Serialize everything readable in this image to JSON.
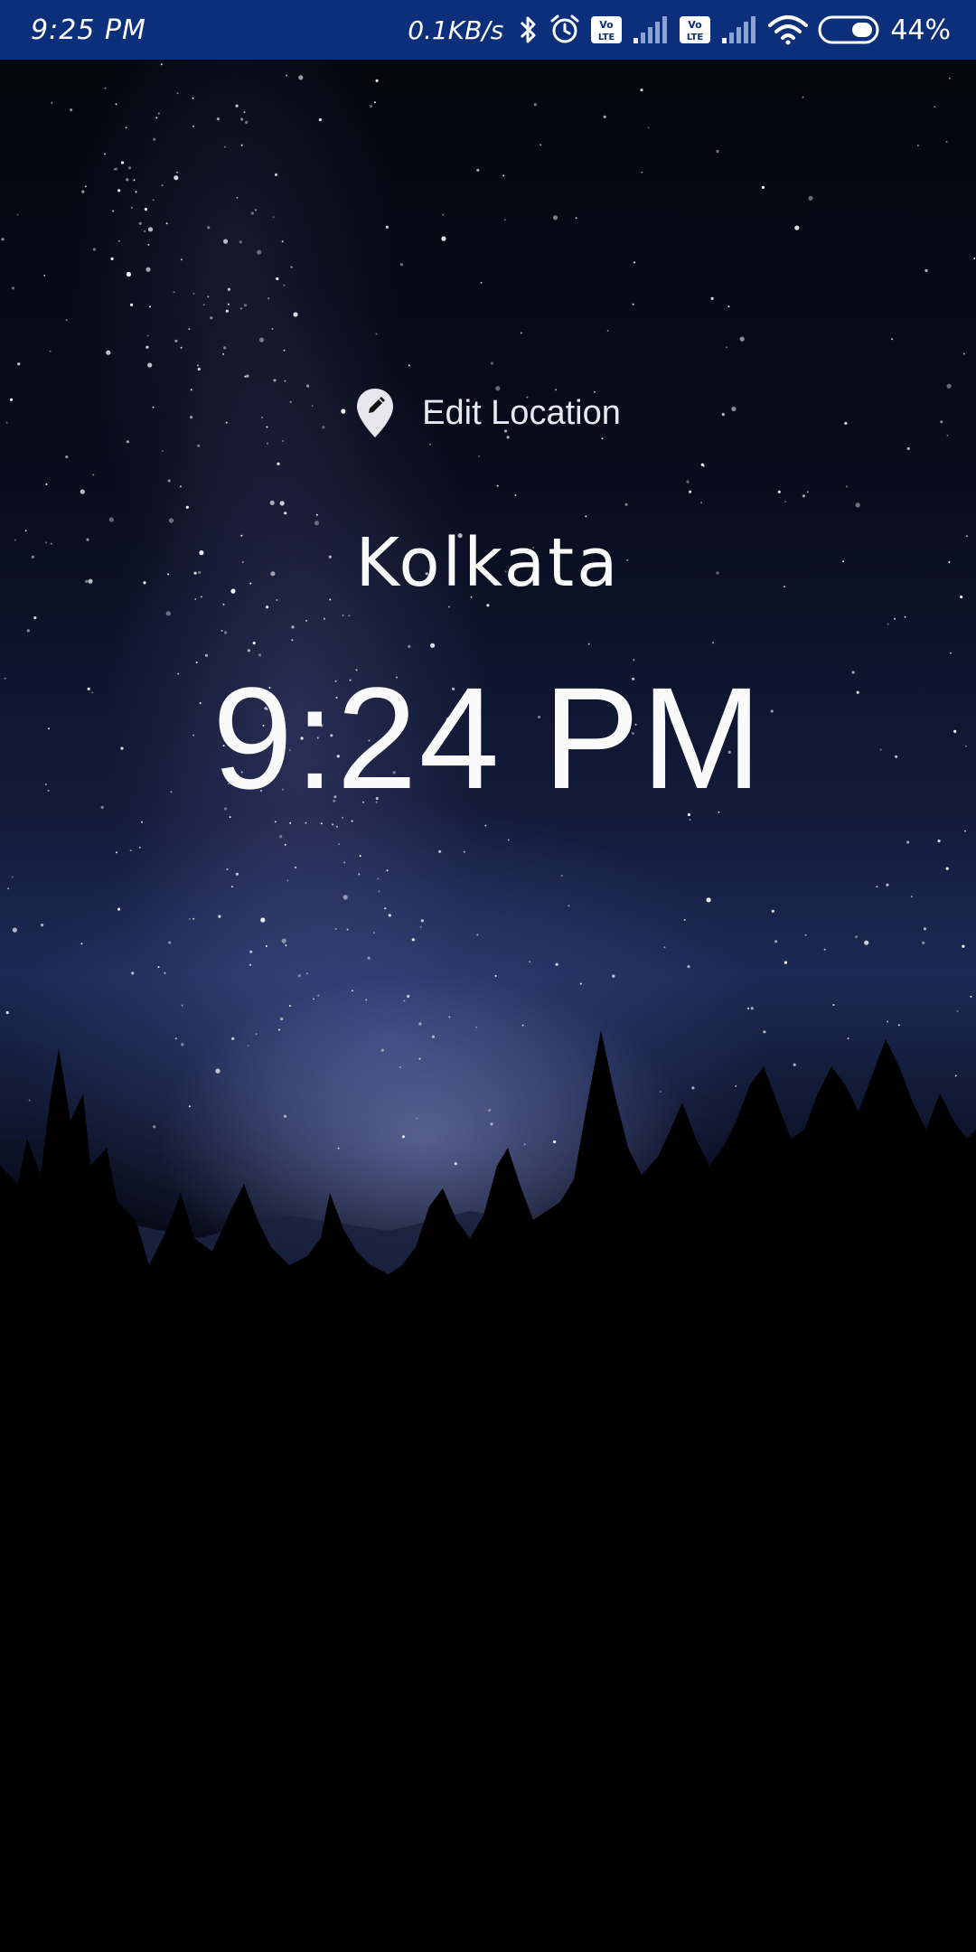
{
  "status_bar": {
    "time": "9:25 PM",
    "network_speed": "0.1KB/s",
    "battery_percent": "44%",
    "background_color": "#0b2f7a",
    "icons": [
      "bluetooth-icon",
      "alarm-icon",
      "volte-icon",
      "cellular-signal-icon",
      "volte-icon",
      "cellular-signal-icon",
      "wifi-icon",
      "battery-icon"
    ]
  },
  "location": {
    "edit_label": "Edit Location",
    "edit_icon": "location-pin-edit-icon",
    "city": "Kolkata",
    "time": "9:24 PM"
  },
  "background": {
    "theme": "night sky with milky way over pine forest"
  }
}
